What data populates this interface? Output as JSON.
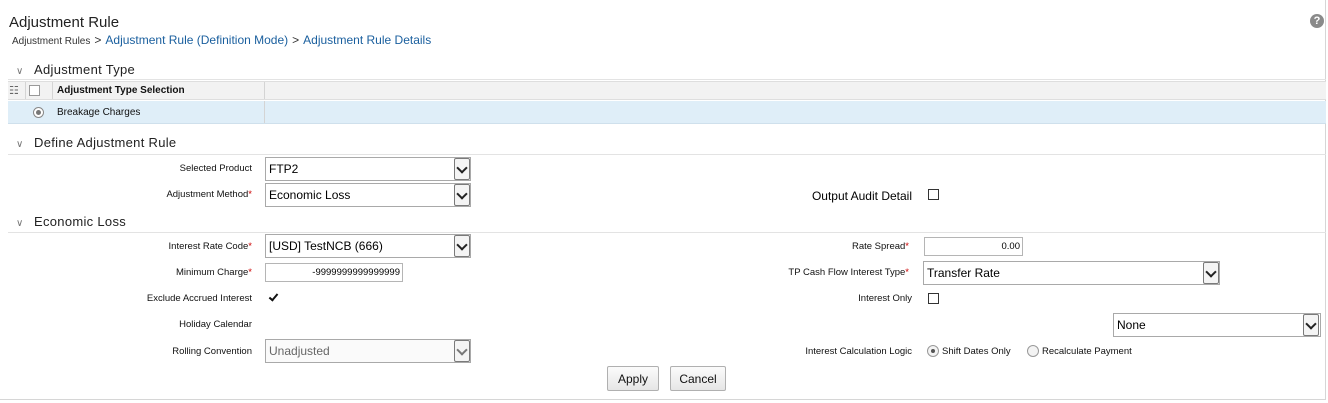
{
  "header": {
    "title": "Adjustment Rule",
    "help_symbol": "?",
    "breadcrumb": {
      "root": "Adjustment Rules",
      "separator": ">",
      "items": [
        "Adjustment Rule (Definition Mode)",
        "Adjustment Rule Details"
      ]
    }
  },
  "sections": {
    "adjustment_type": {
      "title": "Adjustment Type",
      "grid": {
        "column_header": "Adjustment Type Selection",
        "rows": [
          {
            "label": "Breakage Charges",
            "selected": true
          }
        ]
      }
    },
    "define_rule": {
      "title": "Define Adjustment Rule",
      "selected_product": {
        "label": "Selected Product",
        "value": "FTP2"
      },
      "adjustment_method": {
        "label": "Adjustment Method",
        "required": "*",
        "value": "Economic Loss"
      },
      "output_audit_detail": {
        "label": "Output Audit Detail",
        "checked": false
      }
    },
    "economic_loss": {
      "title": "Economic Loss",
      "interest_rate_code": {
        "label": "Interest Rate Code",
        "required": "*",
        "value": "[USD] TestNCB (666)"
      },
      "rate_spread": {
        "label": "Rate Spread",
        "required": "*",
        "value": "0.00"
      },
      "minimum_charge": {
        "label": "Minimum Charge",
        "required": "*",
        "value": "-9999999999999999"
      },
      "tp_cash_flow_interest_type": {
        "label": "TP Cash Flow Interest Type",
        "required": "*",
        "value": "Transfer Rate"
      },
      "exclude_accrued_interest": {
        "label": "Exclude Accrued Interest",
        "checked": true
      },
      "interest_only": {
        "label": "Interest Only",
        "checked": false
      },
      "holiday_calendar": {
        "label": "Holiday Calendar",
        "value": "None"
      },
      "rolling_convention": {
        "label": "Rolling Convention",
        "value": "Unadjusted"
      },
      "interest_calculation_logic": {
        "label": "Interest Calculation Logic",
        "options": [
          "Shift Dates Only",
          "Recalculate Payment"
        ],
        "selected": "Shift Dates Only"
      }
    }
  },
  "actions": {
    "apply": "Apply",
    "cancel": "Cancel"
  },
  "icons": {
    "help": "help-icon",
    "hierarchy": "hierarchy-icon",
    "collapse": "chevron-down-icon",
    "dropdown": "chevron-down-icon"
  },
  "colors": {
    "link": "#1a5f9e",
    "required": "#cc0000",
    "selected_row": "#dfeef8"
  }
}
